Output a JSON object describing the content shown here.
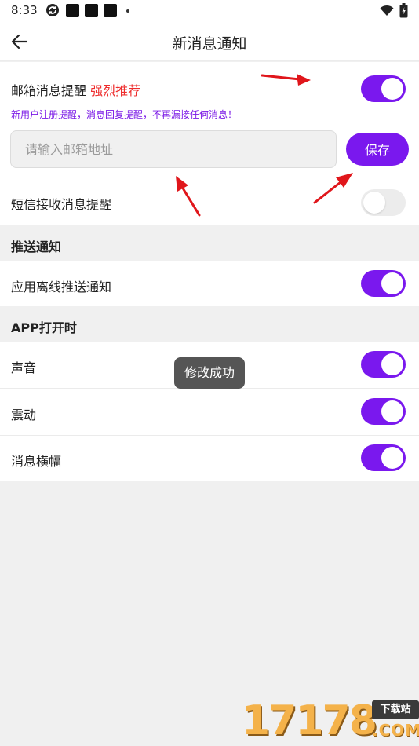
{
  "status_bar": {
    "time": "8:33",
    "icons": [
      "sync-icon",
      "notification-square-icon",
      "notification-square-icon",
      "notification-square-icon",
      "more-dot-icon",
      "wifi-icon",
      "battery-icon"
    ]
  },
  "app_bar": {
    "back_icon": "arrow-left-icon",
    "title": "新消息通知"
  },
  "email_reminder": {
    "label": "邮箱消息提醒",
    "recommend": "强烈推荐",
    "hint": "新用户注册提醒，消息回复提醒，不再漏接任何消息！",
    "input_value": "",
    "input_placeholder": "请输入邮箱地址",
    "save_label": "保存",
    "enabled": true
  },
  "sms_reminder": {
    "label": "短信接收消息提醒",
    "enabled": false
  },
  "push_section": {
    "header": "推送通知",
    "items": [
      {
        "label": "应用离线推送通知",
        "enabled": true
      }
    ]
  },
  "app_open_section": {
    "header": "APP打开时",
    "items": [
      {
        "label": "声音",
        "enabled": true
      },
      {
        "label": "震动",
        "enabled": true
      },
      {
        "label": "消息横幅",
        "enabled": true
      }
    ]
  },
  "toast": {
    "text": "修改成功"
  },
  "watermark": {
    "digits": "17178",
    "badge": "下载站",
    "domain": ".COM"
  },
  "colors": {
    "accent": "#7a18ee",
    "recommend": "#ee2d2d",
    "hint": "#7a18e6",
    "toggle_off": "#ececec",
    "background": "#f0f0f0",
    "annotation_arrow": "#e0161b"
  }
}
